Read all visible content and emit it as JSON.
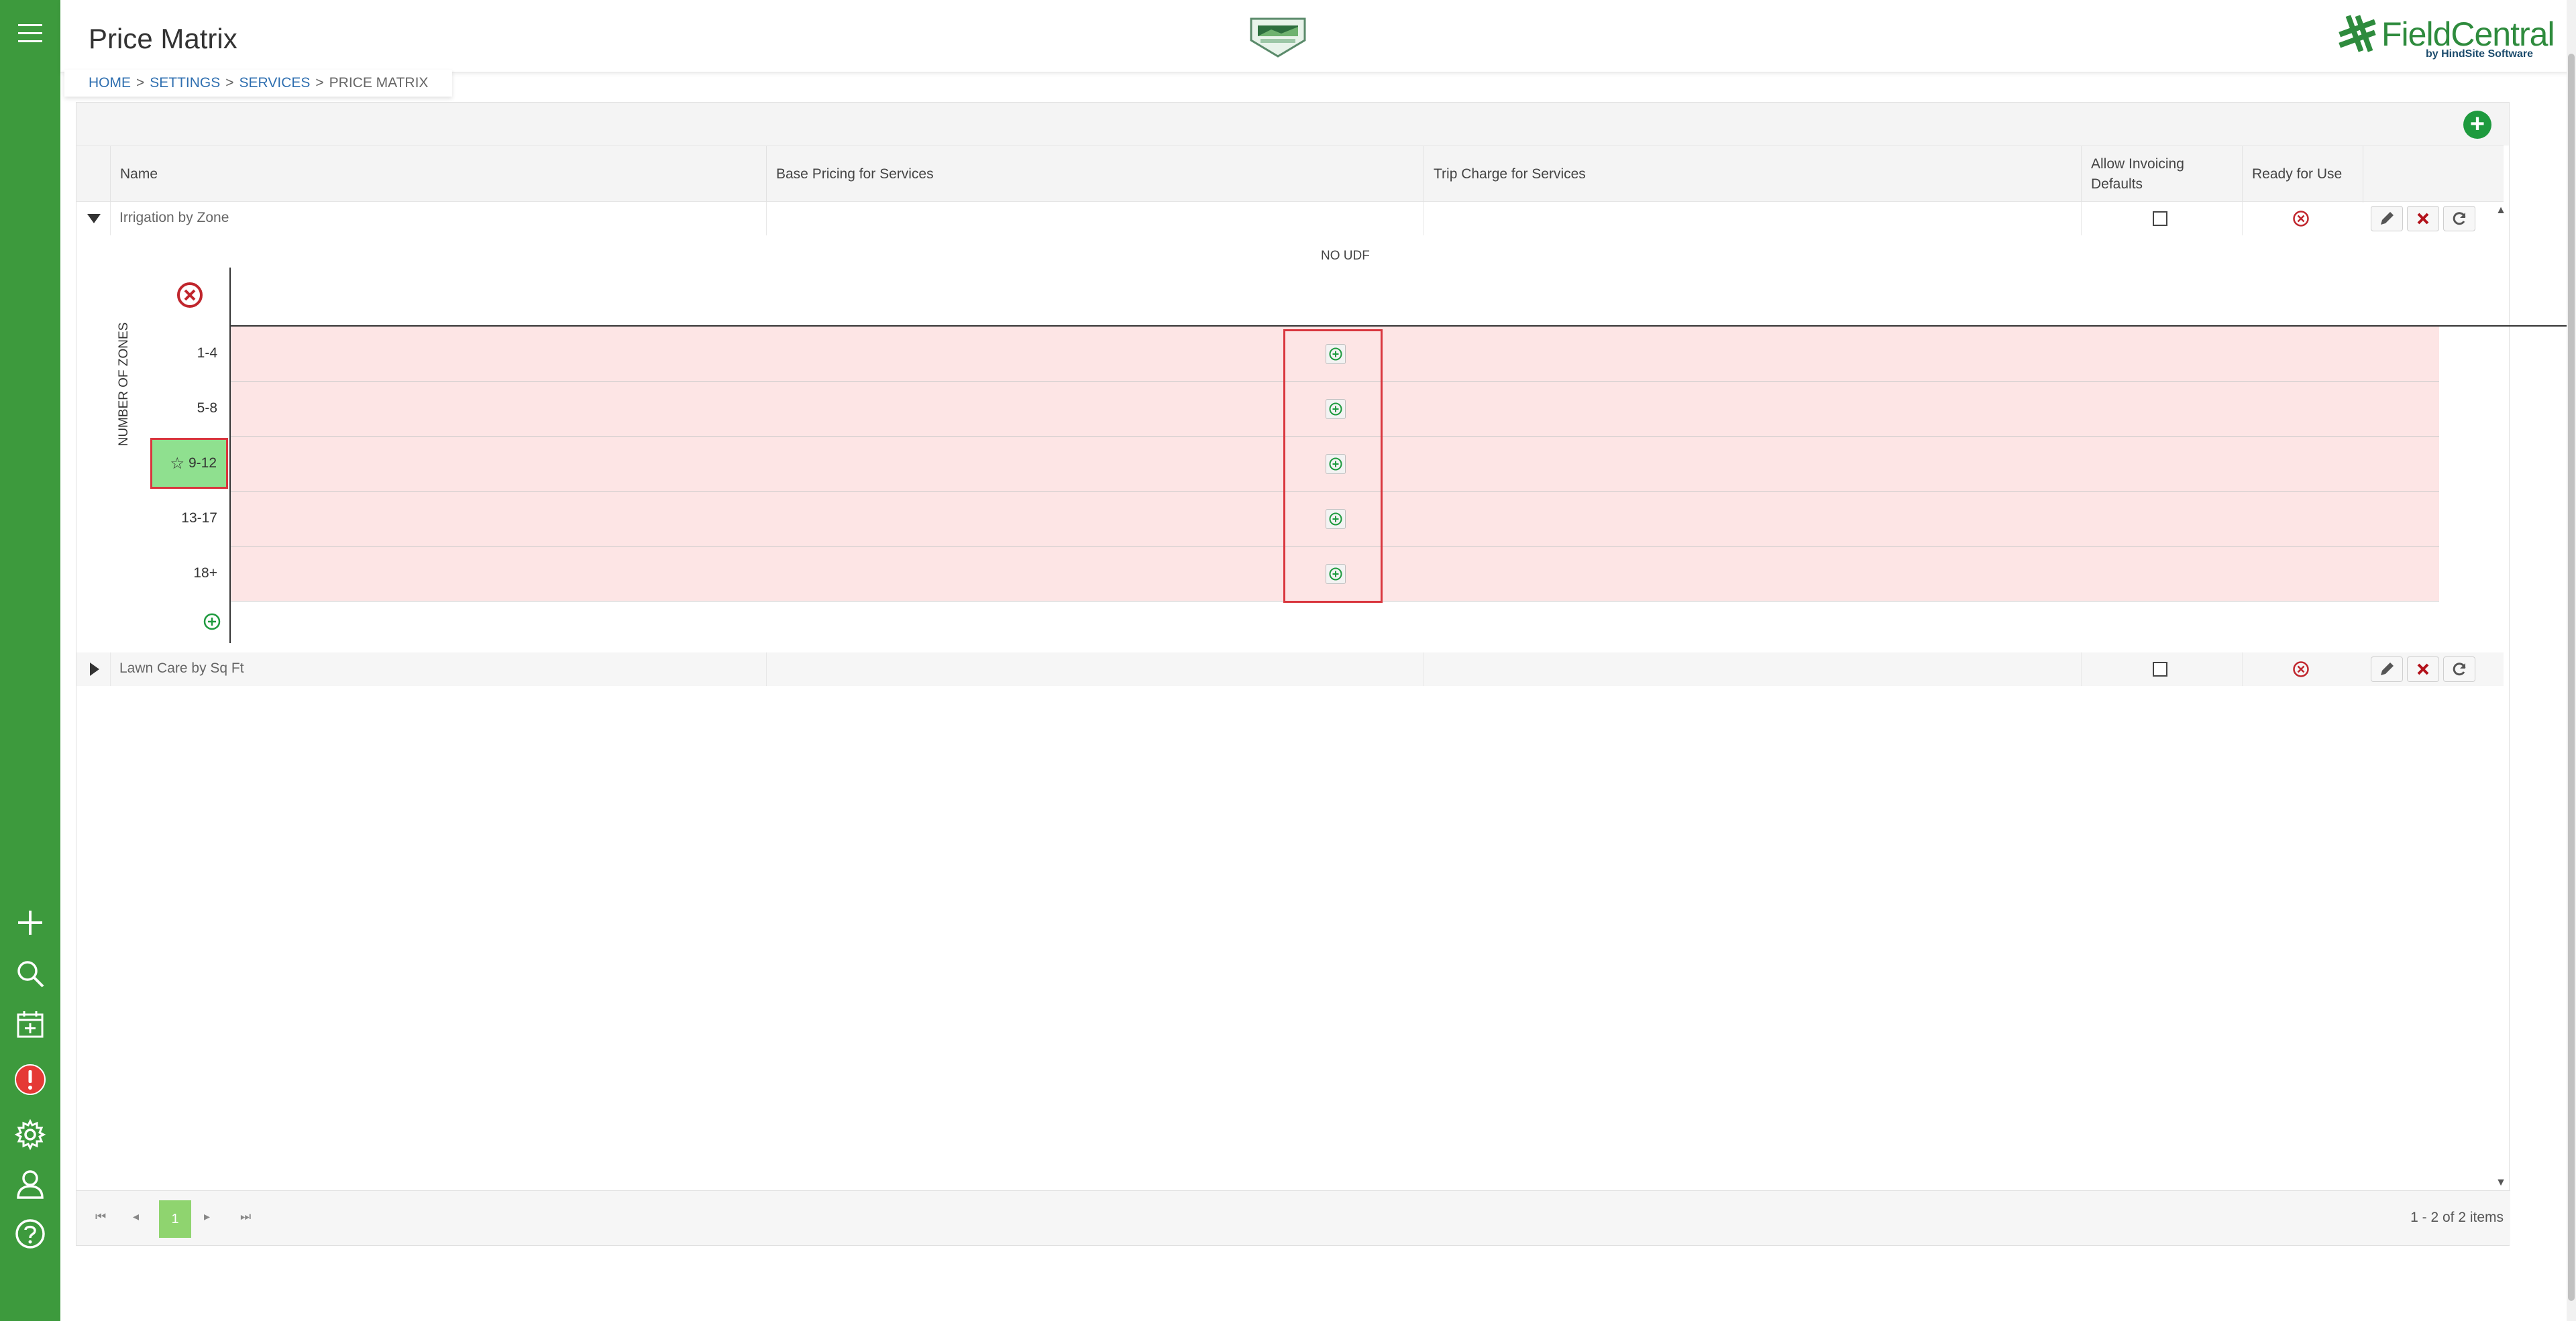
{
  "app": {
    "title": "Price Matrix",
    "brand_name": "FieldCentral",
    "brand_sub": "by HindSite Software"
  },
  "breadcrumb": {
    "home": "HOME",
    "settings": "SETTINGS",
    "services": "SERVICES",
    "current": "PRICE MATRIX",
    "separator": ">"
  },
  "columns": {
    "name": "Name",
    "base_pricing": "Base Pricing for Services",
    "trip_charge": "Trip Charge for Services",
    "allow_invoicing_line1": "Allow Invoicing",
    "allow_invoicing_line2": "Defaults",
    "ready": "Ready for Use"
  },
  "rows": [
    {
      "name": "Irrigation by Zone",
      "expanded": true,
      "allow_invoicing": false,
      "ready": false
    },
    {
      "name": "Lawn Care by Sq Ft",
      "expanded": false,
      "allow_invoicing": false,
      "ready": false
    }
  ],
  "matrix": {
    "udf_label": "NO UDF",
    "axis_label": "NUMBER OF ZONES",
    "zones": [
      "1-4",
      "5-8",
      "9-12",
      "13-17",
      "18+"
    ],
    "selected_zone": "9-12"
  },
  "pager": {
    "current_page": "1",
    "info": "1 - 2 of 2 items"
  },
  "colors": {
    "sidebar": "#3d9a3d",
    "accent": "#1e9a3e",
    "cell_fill": "#fde5e5",
    "selected_zone": "#8fe08f",
    "highlight": "#d9363e"
  },
  "sidebar_icons": [
    "menu-icon",
    "plus-icon",
    "search-icon",
    "calendar-add-icon",
    "alert-icon",
    "gear-icon",
    "user-icon",
    "help-icon"
  ]
}
